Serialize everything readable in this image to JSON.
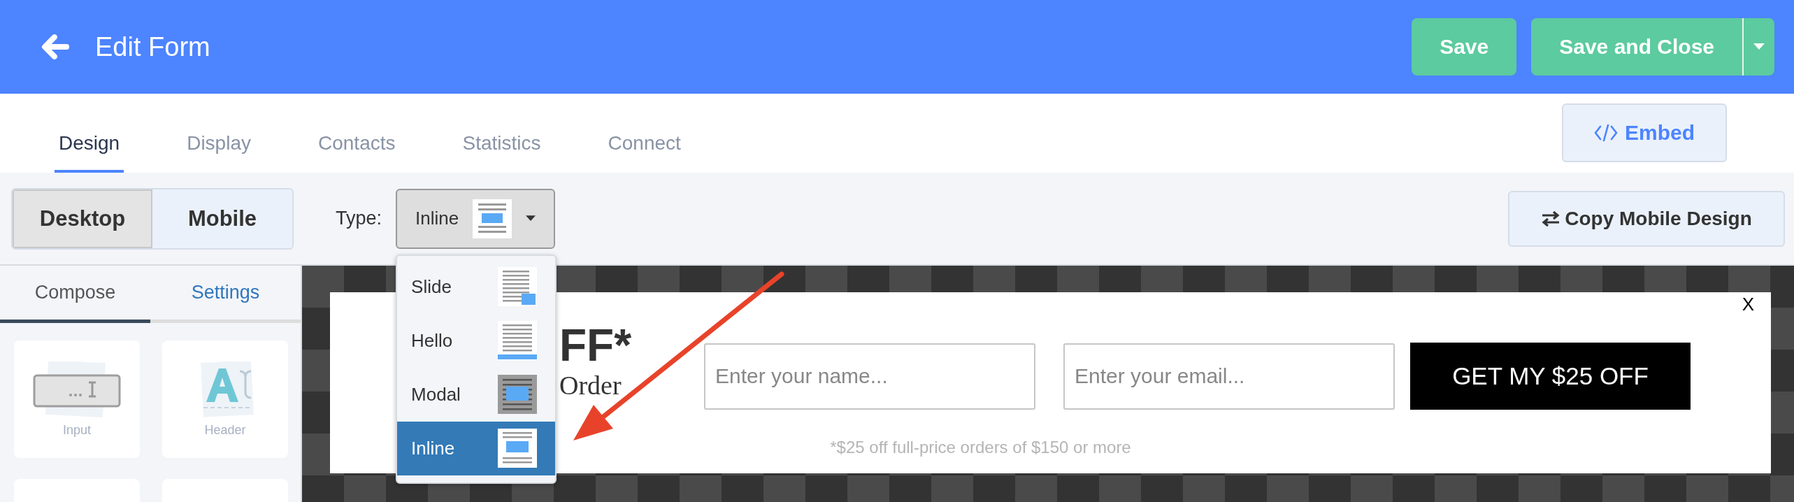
{
  "header": {
    "title": "Edit Form",
    "save": "Save",
    "save_close": "Save and Close"
  },
  "tabs": [
    {
      "label": "Design",
      "selected": true
    },
    {
      "label": "Display",
      "selected": false
    },
    {
      "label": "Contacts",
      "selected": false
    },
    {
      "label": "Statistics",
      "selected": false
    },
    {
      "label": "Connect",
      "selected": false
    }
  ],
  "embed_button": "Embed",
  "device_toggle": [
    {
      "label": "Desktop",
      "selected": true
    },
    {
      "label": "Mobile",
      "selected": false
    }
  ],
  "type_select": {
    "label": "Type:",
    "value": "Inline",
    "kind": "inline",
    "expanded": true
  },
  "type_options": [
    {
      "label": "Slide",
      "kind": "slide",
      "selected": false
    },
    {
      "label": "Hello",
      "kind": "hello",
      "selected": false
    },
    {
      "label": "Modal",
      "kind": "modal",
      "selected": false
    },
    {
      "label": "Inline",
      "kind": "inline",
      "selected": true
    }
  ],
  "copy_button": "Copy Mobile Design",
  "panel_tabs": [
    {
      "label": "Compose",
      "selected": true
    },
    {
      "label": "Settings",
      "selected": false
    }
  ],
  "elements": [
    {
      "label": "Input",
      "kind": "input"
    },
    {
      "label": "Header",
      "kind": "header"
    }
  ],
  "form_preview": {
    "headline": "FF*",
    "subline": "Order",
    "name_placeholder": "Enter your name...",
    "email_placeholder": "Enter your email...",
    "button": "GET MY $25 OFF",
    "disclaimer": "*$25 off full-price orders of $150 or more",
    "close": "X"
  }
}
